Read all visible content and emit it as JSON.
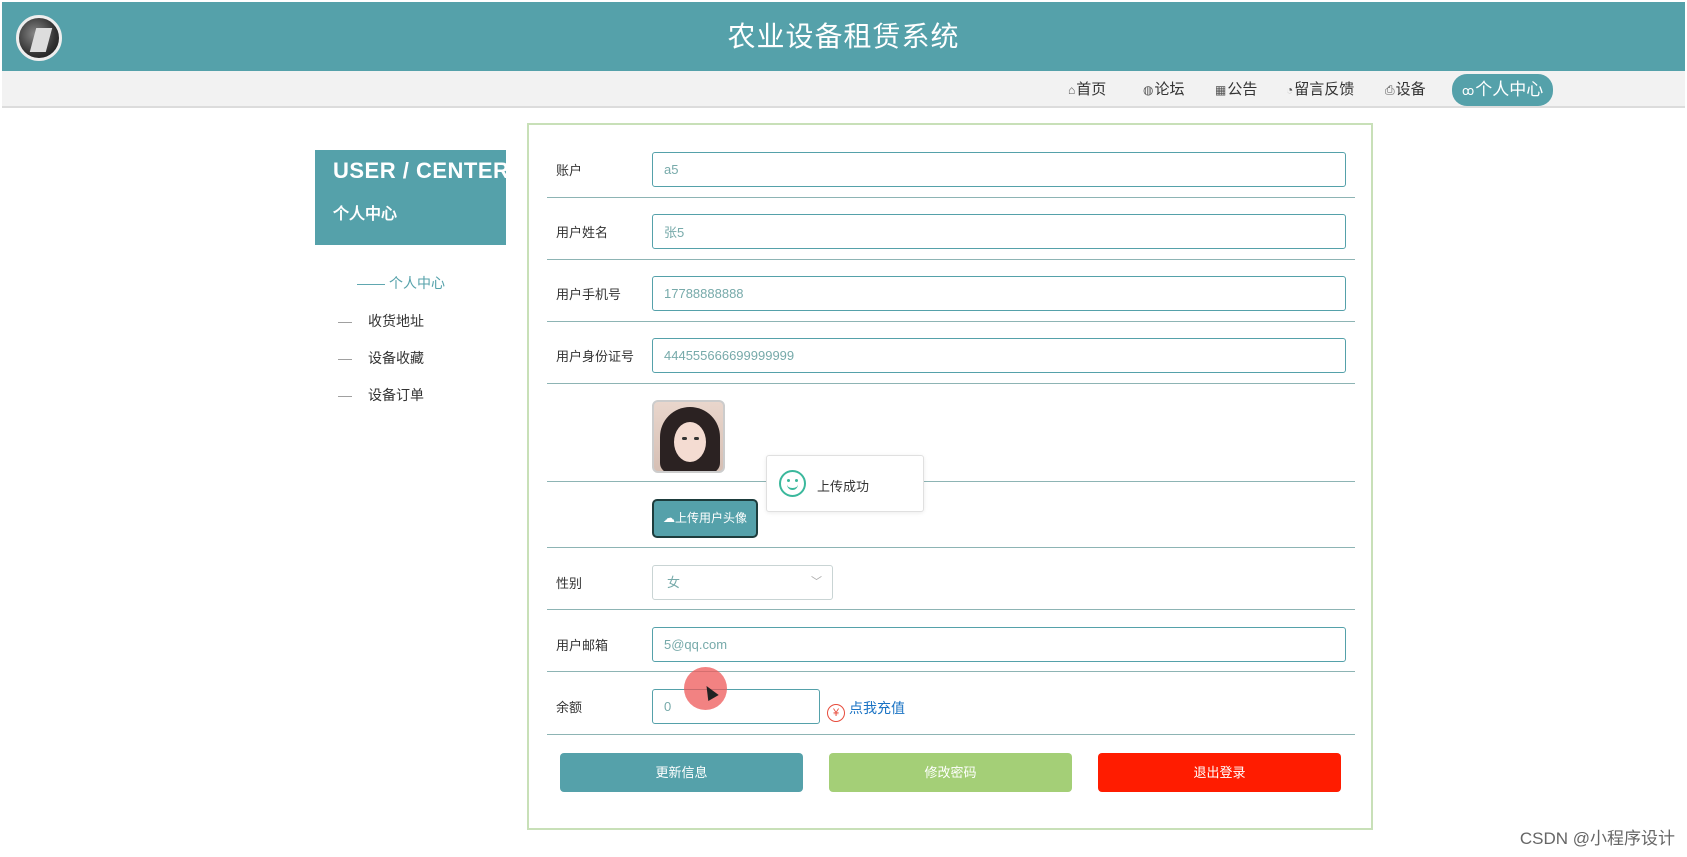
{
  "header": {
    "title": "农业设备租赁系统"
  },
  "nav": {
    "items": [
      {
        "icon": "home-icon",
        "glyph": "⌂",
        "label": "首页"
      },
      {
        "icon": "globe-icon",
        "glyph": "◍",
        "label": "论坛"
      },
      {
        "icon": "calendar-icon",
        "glyph": "▦",
        "label": "公告"
      },
      {
        "icon": "dashboard-icon",
        "glyph": "◔",
        "label": "留言反馈"
      },
      {
        "icon": "printer-icon",
        "glyph": "⎙",
        "label": "设备"
      },
      {
        "icon": "user-icon",
        "glyph": "ꝏ",
        "label": "个人中心"
      }
    ]
  },
  "sidebar": {
    "title_en": "USER / CENTER",
    "title_cn": "个人中心",
    "items": [
      {
        "label": "个人中心",
        "active": true,
        "prefix": "——"
      },
      {
        "label": "收货地址",
        "prefix": "—"
      },
      {
        "label": "设备收藏",
        "prefix": "—"
      },
      {
        "label": "设备订单",
        "prefix": "—"
      }
    ]
  },
  "form": {
    "account_label": "账户",
    "account_value": "a5",
    "name_label": "用户姓名",
    "name_value": "张5",
    "phone_label": "用户手机号",
    "phone_value": "17788888888",
    "idcard_label": "用户身份证号",
    "idcard_value": "444555666699999999",
    "upload_label": "上传用户头像",
    "gender_label": "性别",
    "gender_value": "女",
    "email_label": "用户邮箱",
    "email_value": "5@qq.com",
    "balance_label": "余额",
    "balance_value": "0",
    "recharge_icon": "¥",
    "recharge_label": "点我充值"
  },
  "toast": {
    "text": "上传成功",
    "icon": "smile-icon",
    "color": "#3bb89c"
  },
  "buttons": {
    "update": "更新信息",
    "change_password": "修改密码",
    "logout": "退出登录"
  },
  "watermark": "CSDN @小程序设计",
  "colors": {
    "primary": "#55a1aa",
    "password_btn": "#a4cf77",
    "logout_btn": "#ff1c00",
    "link": "#1a73c4"
  }
}
